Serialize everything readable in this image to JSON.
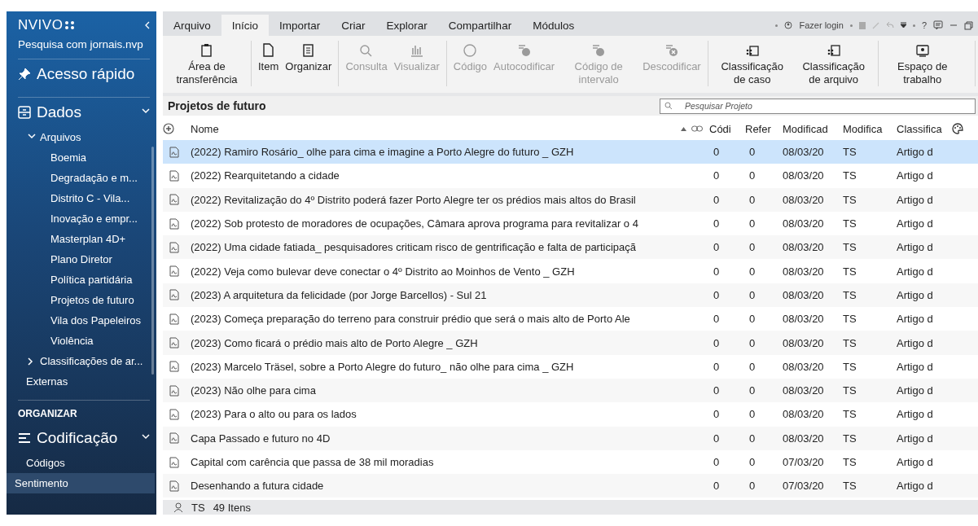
{
  "sidebar": {
    "logo": "NVIVO",
    "project": "Pesquisa com jornais.nvp",
    "quick_access": "Acesso rápido",
    "sections": [
      {
        "kind": "group",
        "title": "Dados",
        "expanded": true,
        "children": [
          {
            "label": "Arquivos",
            "expanded": true,
            "children": [
              {
                "label": "Boemia",
                "selected": false
              },
              {
                "label": "Degradação e m...",
                "selected": false
              },
              {
                "label": "Distrito C - Vila...",
                "selected": false
              },
              {
                "label": "Inovação e empr...",
                "selected": false
              },
              {
                "label": "Masterplan 4D+",
                "selected": false
              },
              {
                "label": "Plano Diretor",
                "selected": false
              },
              {
                "label": "Política partidária",
                "selected": false
              },
              {
                "label": "Projetos de futuro",
                "selected": false
              },
              {
                "label": "Vila dos Papeleiros",
                "selected": false
              },
              {
                "label": "Violência",
                "selected": false
              }
            ]
          },
          {
            "label": "Classificações de ar...",
            "expanded": false
          },
          {
            "label": "Externas",
            "selected": false
          }
        ]
      },
      {
        "kind": "heading",
        "title": "ORGANIZAR"
      },
      {
        "kind": "group",
        "title": "Codificação",
        "expanded": true,
        "children": [
          {
            "label": "Códigos",
            "selected": false
          },
          {
            "label": "Sentimento",
            "selected": true
          }
        ]
      }
    ]
  },
  "tabs": [
    {
      "label": "Arquivo",
      "selected": false
    },
    {
      "label": "Início",
      "selected": true
    },
    {
      "label": "Importar",
      "selected": false
    },
    {
      "label": "Criar",
      "selected": false
    },
    {
      "label": "Explorar",
      "selected": false
    },
    {
      "label": "Compartilhar",
      "selected": false
    },
    {
      "label": "Módulos",
      "selected": false
    }
  ],
  "title_bar": {
    "login": "Fazer login",
    "help": "?"
  },
  "ribbon": [
    [
      {
        "label": "Área de transferência",
        "disabled": false
      }
    ],
    [
      {
        "label": "Item",
        "disabled": false
      },
      {
        "label": "Organizar",
        "disabled": false
      }
    ],
    [
      {
        "label": "Consulta",
        "disabled": true
      },
      {
        "label": "Visualizar",
        "disabled": true
      }
    ],
    [
      {
        "label": "Código",
        "disabled": true
      },
      {
        "label": "Autocodificar",
        "disabled": true
      },
      {
        "label": "Código de intervalo",
        "disabled": true
      },
      {
        "label": "Descodificar",
        "disabled": true
      }
    ],
    [
      {
        "label": "Classificação de caso",
        "disabled": false
      },
      {
        "label": "Classificação de arquivo",
        "disabled": false
      }
    ],
    [
      {
        "label": "Espaço de trabalho",
        "disabled": false
      }
    ]
  ],
  "list": {
    "title": "Projetos de futuro",
    "search": {
      "placeholder": "Pesquisar Projeto"
    },
    "columns": [
      "Nome",
      "Códi",
      "Refer",
      "Modificad",
      "Modifica",
      "Classifica"
    ],
    "rows": [
      {
        "name": "(2022) Ramiro Rosário_ olhe para cima e imagine a Porto Alegre do futuro _ GZH",
        "codes": "0",
        "refs": "0",
        "modified": "08/03/20",
        "by": "TS",
        "class": "Artigo d",
        "selected": true
      },
      {
        "name": "(2022) Rearquitetando a cidade",
        "codes": "0",
        "refs": "0",
        "modified": "08/03/20",
        "by": "TS",
        "class": "Artigo d",
        "selected": false
      },
      {
        "name": "(2022) Revitalização do 4º Distrito poderá fazer Porto Alegre ter os prédios mais altos do Brasil",
        "codes": "0",
        "refs": "0",
        "modified": "08/03/20",
        "by": "TS",
        "class": "Artigo d",
        "selected": false
      },
      {
        "name": "(2022) Sob protesto de moradores de ocupações, Câmara aprova programa para revitalizar o 4",
        "codes": "0",
        "refs": "0",
        "modified": "08/03/20",
        "by": "TS",
        "class": "Artigo d",
        "selected": false
      },
      {
        "name": "(2022) Uma cidade fatiada_ pesquisadores criticam risco de gentrificação e falta de participaçã",
        "codes": "0",
        "refs": "0",
        "modified": "08/03/20",
        "by": "TS",
        "class": "Artigo d",
        "selected": false
      },
      {
        "name": "(2022) Veja como bulevar deve conectar o 4º Distrito ao Moinhos de Vento _ GZH",
        "codes": "0",
        "refs": "0",
        "modified": "08/03/20",
        "by": "TS",
        "class": "Artigo d",
        "selected": false
      },
      {
        "name": "(2023) A arquitetura da felicidade (por Jorge Barcellos) - Sul 21",
        "codes": "0",
        "refs": "0",
        "modified": "08/03/20",
        "by": "TS",
        "class": "Artigo d",
        "selected": false
      },
      {
        "name": "(2023) Começa preparação do terreno para construir prédio que será o mais alto de Porto Ale",
        "codes": "0",
        "refs": "0",
        "modified": "08/03/20",
        "by": "TS",
        "class": "Artigo d",
        "selected": false
      },
      {
        "name": "(2023) Como ficará o prédio mais alto de Porto Alegre _ GZH",
        "codes": "0",
        "refs": "0",
        "modified": "08/03/20",
        "by": "TS",
        "class": "Artigo d",
        "selected": false
      },
      {
        "name": "(2023) Marcelo Träsel, sobre a Porto Alegre do futuro_ não olhe para cima _ GZH",
        "codes": "0",
        "refs": "0",
        "modified": "08/03/20",
        "by": "TS",
        "class": "Artigo d",
        "selected": false
      },
      {
        "name": "(2023) Não olhe para cima",
        "codes": "0",
        "refs": "0",
        "modified": "08/03/20",
        "by": "TS",
        "class": "Artigo d",
        "selected": false
      },
      {
        "name": "(2023) Para o alto ou para os lados",
        "codes": "0",
        "refs": "0",
        "modified": "08/03/20",
        "by": "TS",
        "class": "Artigo d",
        "selected": false
      },
      {
        "name": "Capa Passado e futuro no 4D",
        "codes": "0",
        "refs": "0",
        "modified": "08/03/20",
        "by": "TS",
        "class": "Artigo d",
        "selected": false
      },
      {
        "name": "Capital com carência que passa de 38 mil moradias",
        "codes": "0",
        "refs": "0",
        "modified": "07/03/20",
        "by": "TS",
        "class": "Artigo d",
        "selected": false
      },
      {
        "name": "Desenhando a futura cidade",
        "codes": "0",
        "refs": "0",
        "modified": "07/03/20",
        "by": "TS",
        "class": "Artigo d",
        "selected": false
      }
    ]
  },
  "status_bar": {
    "user": "TS",
    "count": "49 Itens"
  }
}
